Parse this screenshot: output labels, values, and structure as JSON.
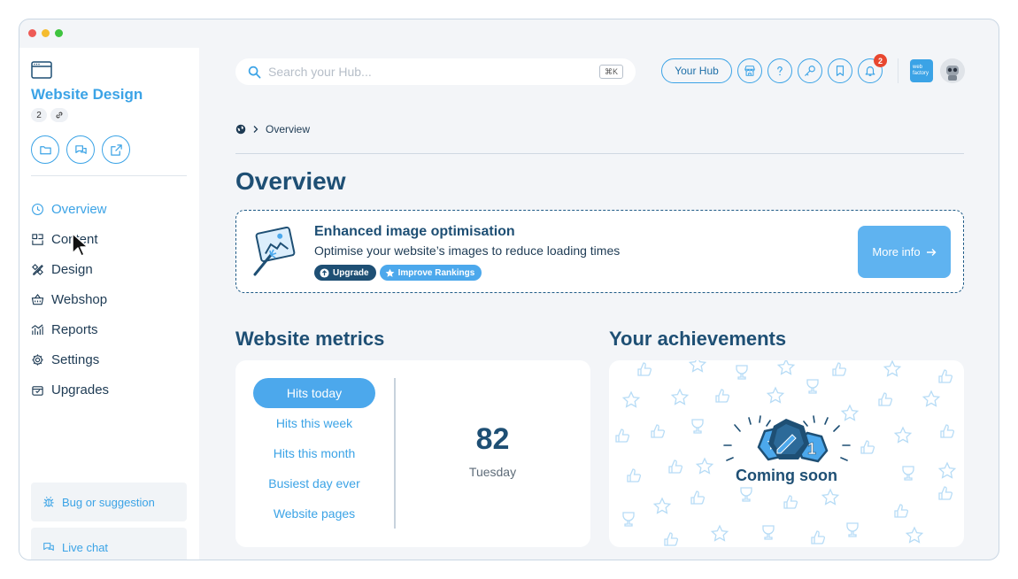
{
  "window": {
    "dot_colors": [
      "#ee5b56",
      "#f5bc2f",
      "#3fc43f"
    ]
  },
  "sidebar": {
    "project_title": "Website Design",
    "count": "2",
    "nav": [
      {
        "label": "Overview",
        "icon": "clock-icon",
        "active": true
      },
      {
        "label": "Content",
        "icon": "layout-icon"
      },
      {
        "label": "Design",
        "icon": "pencil-ruler-icon"
      },
      {
        "label": "Webshop",
        "icon": "basket-icon"
      },
      {
        "label": "Reports",
        "icon": "chart-icon"
      },
      {
        "label": "Settings",
        "icon": "gear-icon"
      },
      {
        "label": "Upgrades",
        "icon": "gift-icon"
      }
    ],
    "bug_label": "Bug or suggestion",
    "chat_label": "Live chat"
  },
  "header": {
    "search_placeholder": "Search your Hub...",
    "shortcut": "⌘K",
    "hub_label": "Your Hub",
    "notification_count": "2",
    "brand_line1": "web",
    "brand_line2": "factory"
  },
  "breadcrumb": {
    "current": "Overview"
  },
  "page_title": "Overview",
  "promo": {
    "title": "Enhanced image optimisation",
    "description": "Optimise your website’s images to reduce loading times",
    "tag_upgrade": "Upgrade",
    "tag_rankings": "Improve Rankings",
    "more_label": "More info"
  },
  "metrics": {
    "title": "Website metrics",
    "tabs": [
      "Hits today",
      "Hits this week",
      "Hits this month",
      "Busiest day ever",
      "Website pages"
    ],
    "value": "82",
    "sub": "Tuesday"
  },
  "achievements": {
    "title": "Your achievements",
    "coming_soon": "Coming soon",
    "badge_number": "1"
  },
  "colors": {
    "accent": "#3ba3e6",
    "heading": "#1e4f74",
    "tag_dark": "#1e4f74",
    "tag_light": "#4ca8ec",
    "badge": "#e8472f"
  }
}
